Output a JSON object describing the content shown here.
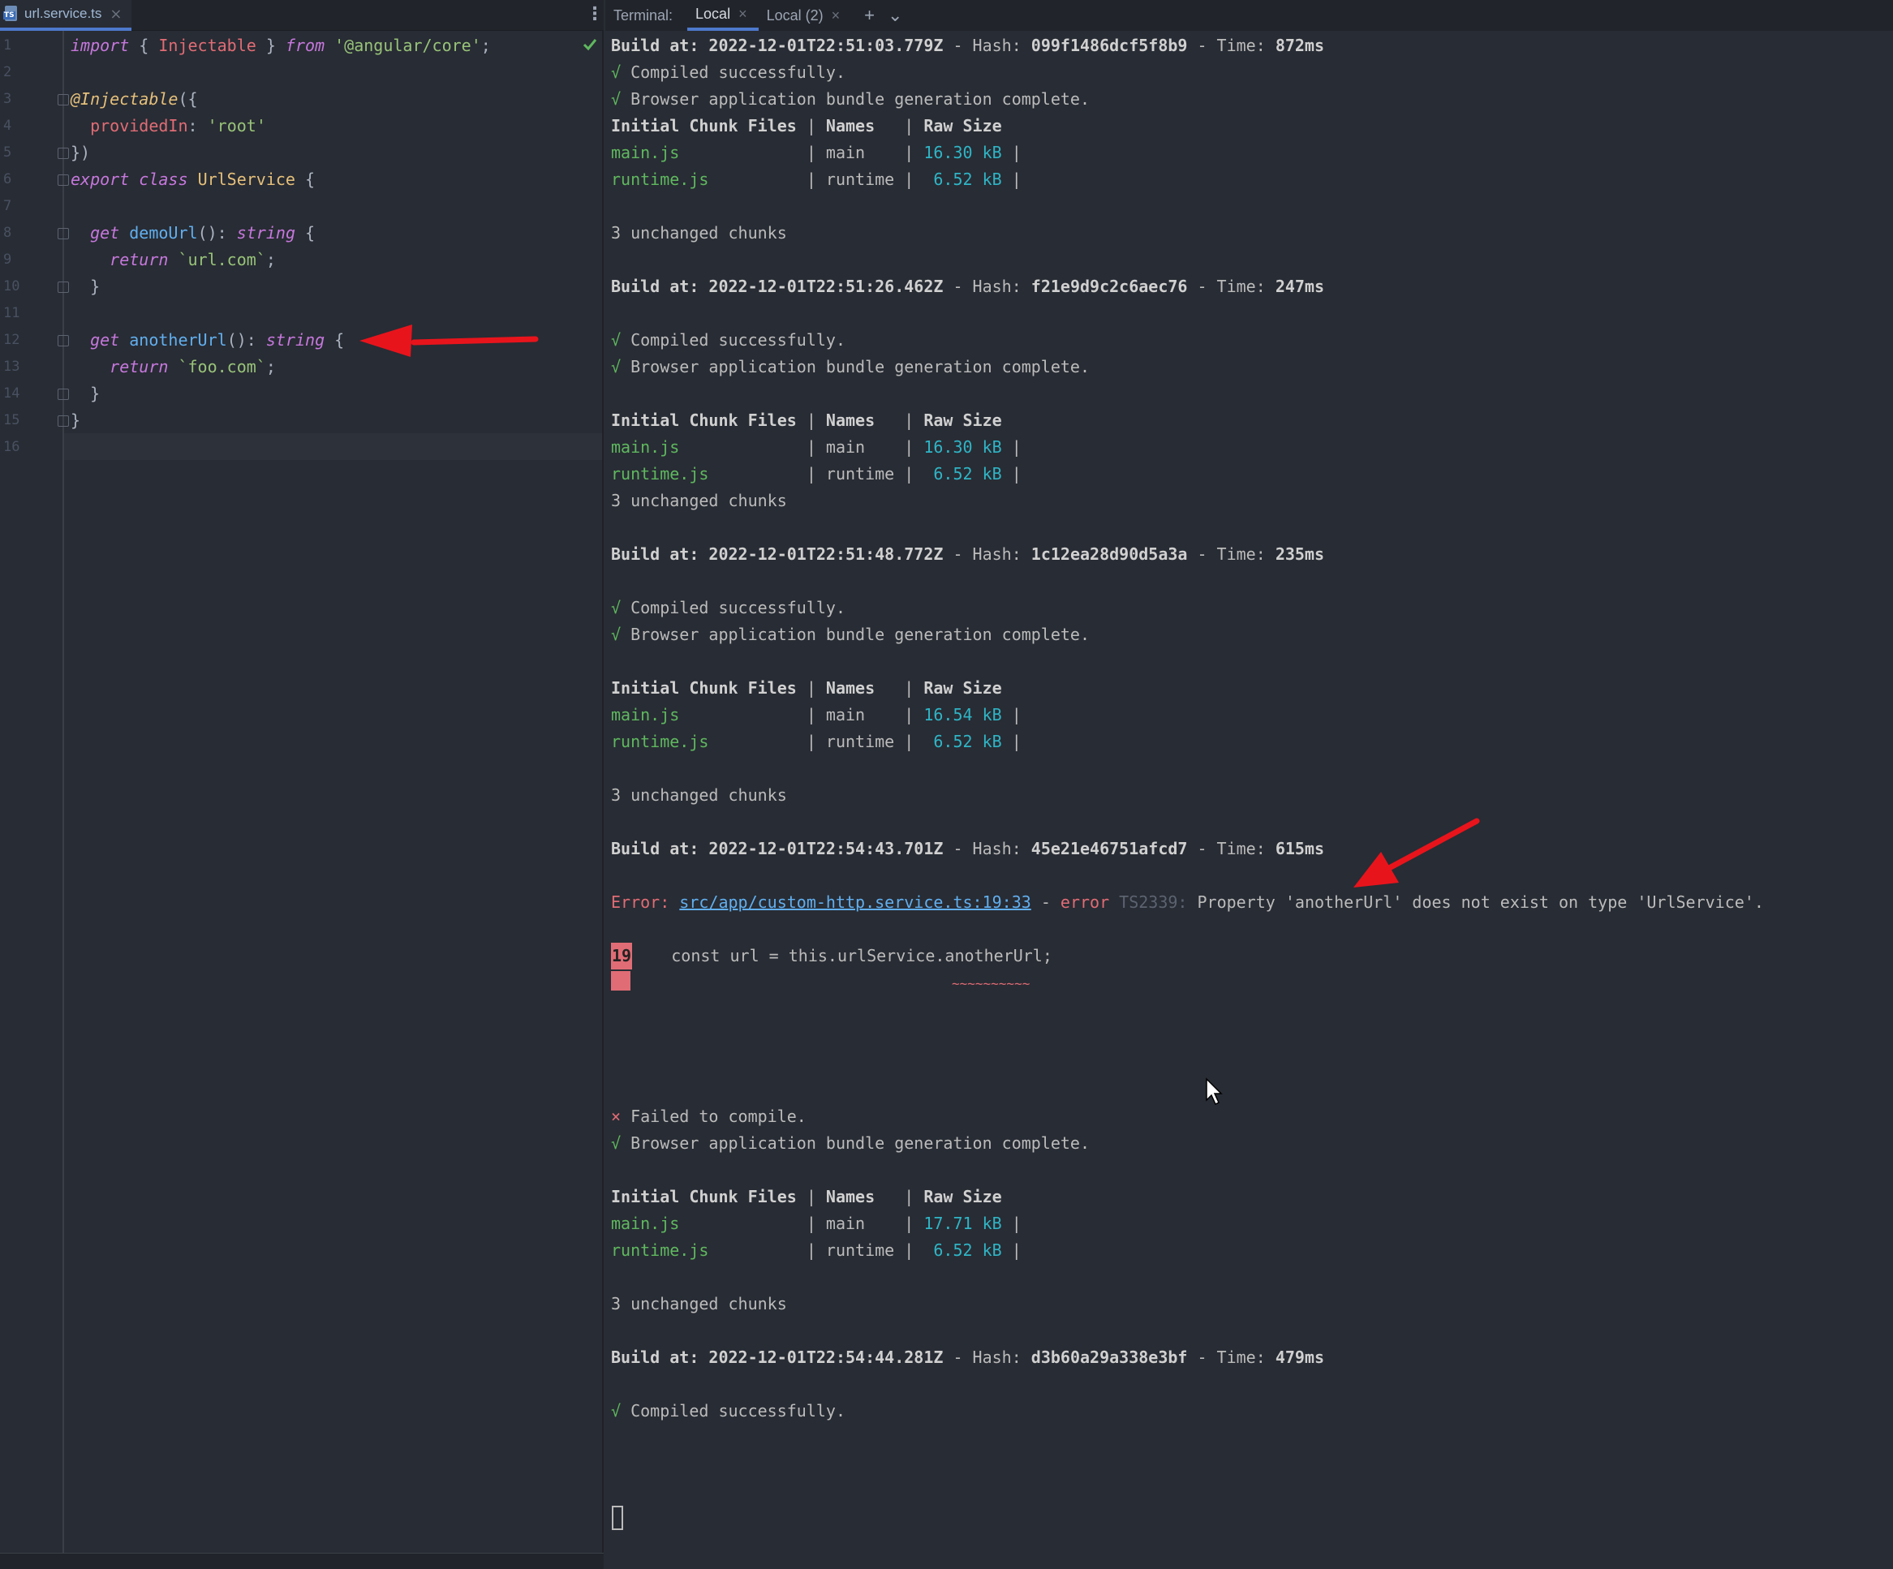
{
  "editor": {
    "tab": {
      "title": "url.service.ts",
      "close": "×"
    },
    "menu_glyph": "⋮",
    "line_numbers": [
      "1",
      "2",
      "3",
      "4",
      "5",
      "6",
      "7",
      "8",
      "9",
      "10",
      "11",
      "12",
      "13",
      "14",
      "15",
      "16"
    ],
    "code": {
      "l1": {
        "a": "import",
        "b": " { ",
        "c": "Injectable",
        "d": " } ",
        "e": "from",
        "f": " ",
        "g": "'@angular/core'",
        "h": ";"
      },
      "l3": {
        "a": "@Injectable",
        "b": "({"
      },
      "l4": {
        "a": "  ",
        "b": "providedIn",
        "c": ": ",
        "d": "'root'"
      },
      "l5": {
        "a": "})"
      },
      "l6": {
        "a": "export",
        "b": " ",
        "c": "class",
        "d": " ",
        "e": "UrlService",
        "f": " {"
      },
      "l8": {
        "a": "  ",
        "b": "get",
        "c": " ",
        "d": "demoUrl",
        "e": "(): ",
        "f": "string",
        "g": " {"
      },
      "l9": {
        "a": "    ",
        "b": "return",
        "c": " ",
        "d": "`url.com`",
        "e": ";"
      },
      "l10": {
        "a": "  }"
      },
      "l12": {
        "a": "  ",
        "b": "get",
        "c": " ",
        "d": "anotherUrl",
        "e": "(): ",
        "f": "string",
        "g": " {"
      },
      "l13": {
        "a": "    ",
        "b": "return",
        "c": " ",
        "d": "`foo.com`",
        "e": ";"
      },
      "l14": {
        "a": "  }"
      },
      "l15": {
        "a": "}"
      }
    }
  },
  "terminal": {
    "label": "Terminal:",
    "tabs": [
      {
        "label": "Local",
        "close": "×"
      },
      {
        "label": "Local (2)",
        "close": "×"
      }
    ],
    "add_glyph": "+",
    "dropdown_glyph": "⌄",
    "build1": {
      "prefix": "Build at: ",
      "date": "2022-12-01T22:51:03.779Z",
      "hash_label": " - Hash: ",
      "hash": "099f1486dcf5f8b9",
      "time_label": " - Time: ",
      "time": "872ms"
    },
    "build2": {
      "prefix": "Build at: ",
      "date": "2022-12-01T22:51:26.462Z",
      "hash_label": " - Hash: ",
      "hash": "f21e9d9c2c6aec76",
      "time_label": " - Time: ",
      "time": "247ms"
    },
    "build3": {
      "prefix": "Build at: ",
      "date": "2022-12-01T22:51:48.772Z",
      "hash_label": " - Hash: ",
      "hash": "1c12ea28d90d5a3a",
      "time_label": " - Time: ",
      "time": "235ms"
    },
    "build4": {
      "prefix": "Build at: ",
      "date": "2022-12-01T22:54:43.701Z",
      "hash_label": " - Hash: ",
      "hash": "45e21e46751afcd7",
      "time_label": " - Time: ",
      "time": "615ms"
    },
    "build5": {
      "prefix": "Build at: ",
      "date": "2022-12-01T22:54:44.281Z",
      "hash_label": " - Hash: ",
      "hash": "d3b60a29a338e3bf",
      "time_label": " - Time: ",
      "time": "479ms"
    },
    "check": "√",
    "cross": "×",
    "compiled": " Compiled successfully.",
    "bundle": " Browser application bundle generation complete.",
    "failed": " Failed to compile.",
    "table_header": {
      "files": "Initial Chunk Files",
      "sep1": " | ",
      "names": "Names",
      "sep2": "   | ",
      "raw": "Raw Size"
    },
    "main_file": "main.js",
    "runtime_file": "runtime.js",
    "main_mid": "             | main    | ",
    "runtime_mid": "          | runtime |  ",
    "size_end": " |",
    "sizes": {
      "main1": "16.30 kB",
      "runtime1": "6.52 kB",
      "main2": "16.30 kB",
      "runtime2": "6.52 kB",
      "main3": "16.54 kB",
      "runtime3": "6.52 kB",
      "main4": "17.71 kB",
      "runtime4": "6.52 kB"
    },
    "unchanged": "3 unchanged chunks",
    "error": {
      "label": "Error: ",
      "path": "src/app/custom-http.service.ts:19:33",
      "dash": " - ",
      "error_word": "error",
      "code": " TS2339: ",
      "message": "Property 'anotherUrl' does not exist on type 'UrlService'.",
      "line_no": "19",
      "source": "    const url = this.urlService.anotherUrl;",
      "squiggle": "~~~~~~~~~~"
    }
  }
}
